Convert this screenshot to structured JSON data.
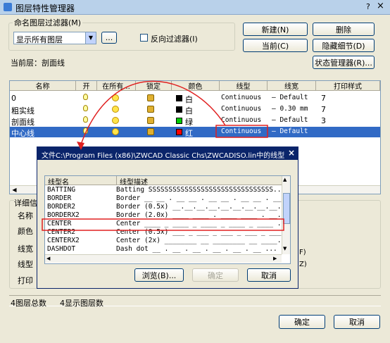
{
  "window": {
    "title": "图层特性管理器",
    "help": "?",
    "close": "×"
  },
  "filter": {
    "group_label": "命名图层过滤器(M)",
    "selected": "显示所有图层",
    "ellipsis": "...",
    "invert_label": "反向过滤器(I)"
  },
  "buttons": {
    "new": "新建(N)",
    "delete": "删除",
    "current": "当前(C)",
    "hide_details": "隐藏细节(D)",
    "state_manager": "状态管理器(R)...",
    "ok": "确定",
    "cancel": "取消"
  },
  "current_layer": "当前层：剖面线",
  "table": {
    "headers": [
      "名称",
      "开",
      "在所有...",
      "锁定",
      "颜色",
      "线型",
      "线宽",
      "打印样式"
    ],
    "rows": [
      {
        "name": "0",
        "color": "白",
        "color_hex": "#000000",
        "linetype": "Continuous",
        "lineweight": "— Default",
        "plot": "7",
        "selected": false
      },
      {
        "name": "粗实线",
        "color": "白",
        "color_hex": "#000000",
        "linetype": "Continuous",
        "lineweight": "— 0.30 mm",
        "plot": "7",
        "selected": false
      },
      {
        "name": "剖面线",
        "color": "绿",
        "color_hex": "#00cc00",
        "linetype": "Continuous",
        "lineweight": "— Default",
        "plot": "3",
        "selected": false
      },
      {
        "name": "中心线",
        "color": "红",
        "color_hex": "#ff0000",
        "linetype": "Continuous",
        "lineweight": "— Default",
        "plot": "",
        "selected": true
      }
    ]
  },
  "details": {
    "group_label": "详细信",
    "labels": [
      "名称",
      "颜色",
      "线宽",
      "线型",
      "打印"
    ],
    "right_marks": [
      "F)",
      "Z)"
    ]
  },
  "status": {
    "total": "4图层总数",
    "shown": "4显示图层数"
  },
  "subdialog": {
    "title": "文件C:\\Program Files (x86)\\ZWCAD Classic Chs\\ZWCADISO.lin中的线型",
    "close": "×",
    "headers": [
      "线型名",
      "线型描述"
    ],
    "rows": [
      {
        "name": "BATTING",
        "desc": "Batting SSSSSSSSSSSSSSSSSSSSSSSSSSSSSSS..."
      },
      {
        "name": "BORDER",
        "desc": "Border __ __ . __ __ . __ __ . __ __ . __ __ ..."
      },
      {
        "name": "BORDER2",
        "desc": "Border (0.5x) __.__.__.__.__.__.__.__.__..."
      },
      {
        "name": "BORDERX2",
        "desc": "Border (2.0x) ____ ____ . ____ ____ . __..."
      },
      {
        "name": "CENTER",
        "desc": "Center ____ _ ____ _ ____ _ ____ _ ____ ..."
      },
      {
        "name": "CENTER2",
        "desc": "Center (0.5x) ___ _ ___ _ ___ _ ___ _ ___..."
      },
      {
        "name": "CENTERX2",
        "desc": "Center (2x) ________ __ ________ __ ____..."
      },
      {
        "name": "DASHDOT",
        "desc": "Dash dot __ . __ . __ . __ . __ . __ ..."
      }
    ],
    "browse": "浏览(B)...",
    "ok": "确定",
    "cancel": "取消"
  },
  "colors": {
    "selection": "#316ac5",
    "annotation": "#e02020",
    "dialog_title": "#0a246a"
  }
}
